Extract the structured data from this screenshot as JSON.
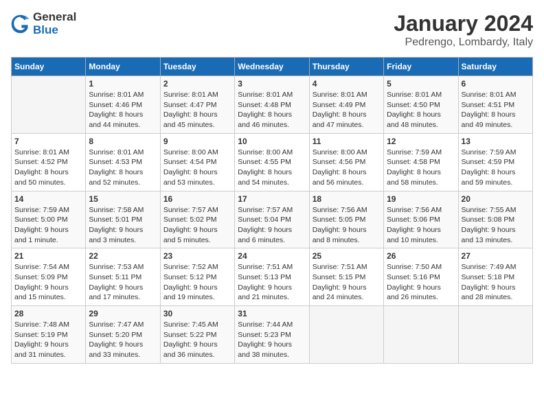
{
  "logo": {
    "line1": "General",
    "line2": "Blue"
  },
  "title": "January 2024",
  "subtitle": "Pedrengo, Lombardy, Italy",
  "days_header": [
    "Sunday",
    "Monday",
    "Tuesday",
    "Wednesday",
    "Thursday",
    "Friday",
    "Saturday"
  ],
  "weeks": [
    [
      {
        "day": "",
        "info": ""
      },
      {
        "day": "1",
        "info": "Sunrise: 8:01 AM\nSunset: 4:46 PM\nDaylight: 8 hours\nand 44 minutes."
      },
      {
        "day": "2",
        "info": "Sunrise: 8:01 AM\nSunset: 4:47 PM\nDaylight: 8 hours\nand 45 minutes."
      },
      {
        "day": "3",
        "info": "Sunrise: 8:01 AM\nSunset: 4:48 PM\nDaylight: 8 hours\nand 46 minutes."
      },
      {
        "day": "4",
        "info": "Sunrise: 8:01 AM\nSunset: 4:49 PM\nDaylight: 8 hours\nand 47 minutes."
      },
      {
        "day": "5",
        "info": "Sunrise: 8:01 AM\nSunset: 4:50 PM\nDaylight: 8 hours\nand 48 minutes."
      },
      {
        "day": "6",
        "info": "Sunrise: 8:01 AM\nSunset: 4:51 PM\nDaylight: 8 hours\nand 49 minutes."
      }
    ],
    [
      {
        "day": "7",
        "info": "Sunrise: 8:01 AM\nSunset: 4:52 PM\nDaylight: 8 hours\nand 50 minutes."
      },
      {
        "day": "8",
        "info": "Sunrise: 8:01 AM\nSunset: 4:53 PM\nDaylight: 8 hours\nand 52 minutes."
      },
      {
        "day": "9",
        "info": "Sunrise: 8:00 AM\nSunset: 4:54 PM\nDaylight: 8 hours\nand 53 minutes."
      },
      {
        "day": "10",
        "info": "Sunrise: 8:00 AM\nSunset: 4:55 PM\nDaylight: 8 hours\nand 54 minutes."
      },
      {
        "day": "11",
        "info": "Sunrise: 8:00 AM\nSunset: 4:56 PM\nDaylight: 8 hours\nand 56 minutes."
      },
      {
        "day": "12",
        "info": "Sunrise: 7:59 AM\nSunset: 4:58 PM\nDaylight: 8 hours\nand 58 minutes."
      },
      {
        "day": "13",
        "info": "Sunrise: 7:59 AM\nSunset: 4:59 PM\nDaylight: 8 hours\nand 59 minutes."
      }
    ],
    [
      {
        "day": "14",
        "info": "Sunrise: 7:59 AM\nSunset: 5:00 PM\nDaylight: 9 hours\nand 1 minute."
      },
      {
        "day": "15",
        "info": "Sunrise: 7:58 AM\nSunset: 5:01 PM\nDaylight: 9 hours\nand 3 minutes."
      },
      {
        "day": "16",
        "info": "Sunrise: 7:57 AM\nSunset: 5:02 PM\nDaylight: 9 hours\nand 5 minutes."
      },
      {
        "day": "17",
        "info": "Sunrise: 7:57 AM\nSunset: 5:04 PM\nDaylight: 9 hours\nand 6 minutes."
      },
      {
        "day": "18",
        "info": "Sunrise: 7:56 AM\nSunset: 5:05 PM\nDaylight: 9 hours\nand 8 minutes."
      },
      {
        "day": "19",
        "info": "Sunrise: 7:56 AM\nSunset: 5:06 PM\nDaylight: 9 hours\nand 10 minutes."
      },
      {
        "day": "20",
        "info": "Sunrise: 7:55 AM\nSunset: 5:08 PM\nDaylight: 9 hours\nand 13 minutes."
      }
    ],
    [
      {
        "day": "21",
        "info": "Sunrise: 7:54 AM\nSunset: 5:09 PM\nDaylight: 9 hours\nand 15 minutes."
      },
      {
        "day": "22",
        "info": "Sunrise: 7:53 AM\nSunset: 5:11 PM\nDaylight: 9 hours\nand 17 minutes."
      },
      {
        "day": "23",
        "info": "Sunrise: 7:52 AM\nSunset: 5:12 PM\nDaylight: 9 hours\nand 19 minutes."
      },
      {
        "day": "24",
        "info": "Sunrise: 7:51 AM\nSunset: 5:13 PM\nDaylight: 9 hours\nand 21 minutes."
      },
      {
        "day": "25",
        "info": "Sunrise: 7:51 AM\nSunset: 5:15 PM\nDaylight: 9 hours\nand 24 minutes."
      },
      {
        "day": "26",
        "info": "Sunrise: 7:50 AM\nSunset: 5:16 PM\nDaylight: 9 hours\nand 26 minutes."
      },
      {
        "day": "27",
        "info": "Sunrise: 7:49 AM\nSunset: 5:18 PM\nDaylight: 9 hours\nand 28 minutes."
      }
    ],
    [
      {
        "day": "28",
        "info": "Sunrise: 7:48 AM\nSunset: 5:19 PM\nDaylight: 9 hours\nand 31 minutes."
      },
      {
        "day": "29",
        "info": "Sunrise: 7:47 AM\nSunset: 5:20 PM\nDaylight: 9 hours\nand 33 minutes."
      },
      {
        "day": "30",
        "info": "Sunrise: 7:45 AM\nSunset: 5:22 PM\nDaylight: 9 hours\nand 36 minutes."
      },
      {
        "day": "31",
        "info": "Sunrise: 7:44 AM\nSunset: 5:23 PM\nDaylight: 9 hours\nand 38 minutes."
      },
      {
        "day": "",
        "info": ""
      },
      {
        "day": "",
        "info": ""
      },
      {
        "day": "",
        "info": ""
      }
    ]
  ]
}
